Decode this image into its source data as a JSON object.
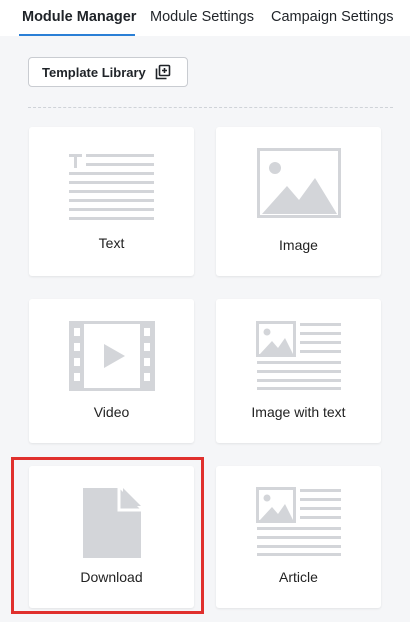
{
  "tabs": [
    {
      "label": "Module Manager",
      "active": true
    },
    {
      "label": "Module Settings",
      "active": false
    },
    {
      "label": "Campaign Settings",
      "active": false
    }
  ],
  "toolbar": {
    "template_library_label": "Template Library",
    "template_library_icon": "add-library-icon"
  },
  "modules": [
    {
      "label": "Text",
      "icon": "text-module-icon"
    },
    {
      "label": "Image",
      "icon": "image-module-icon"
    },
    {
      "label": "Video",
      "icon": "video-module-icon"
    },
    {
      "label": "Image with text",
      "icon": "image-with-text-module-icon"
    },
    {
      "label": "Download",
      "icon": "download-module-icon",
      "highlighted": true
    },
    {
      "label": "Article",
      "icon": "article-module-icon"
    }
  ],
  "colors": {
    "accent": "#2a7fd6",
    "icon_gray": "#d3d5d9",
    "highlight_red": "#e0302d",
    "background": "#f5f6f8"
  }
}
